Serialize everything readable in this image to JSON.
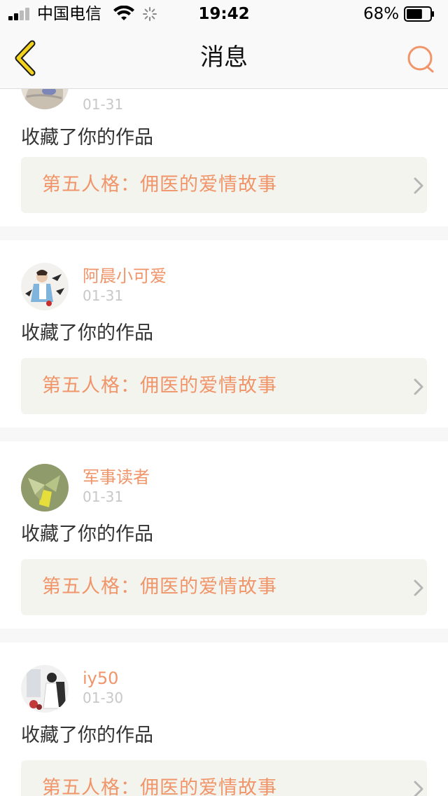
{
  "status_bar": {
    "carrier": "中国电信",
    "time": "19:42",
    "battery": "68%",
    "battery_level": 0.68,
    "icons": [
      "signal-icon",
      "wifi-icon",
      "activity-spinner-icon",
      "battery-icon"
    ]
  },
  "nav": {
    "title": "消息",
    "back_icon": "chevron-left-icon",
    "search_icon": "search-icon"
  },
  "colors": {
    "accent": "#f0956a",
    "back_icon_yellow": "#f2d21c",
    "date_gray": "#c8c8c8",
    "link_bg": "#f4f4ee",
    "page_bg": "#f7f7f7"
  },
  "messages": [
    {
      "username": "",
      "date": "01-31",
      "action": "收藏了你的作品",
      "work_title": "第五人格：佣医的爱情故事"
    },
    {
      "username": "阿晨小可爱",
      "date": "01-31",
      "action": "收藏了你的作品",
      "work_title": "第五人格：佣医的爱情故事"
    },
    {
      "username": "军事读者",
      "date": "01-31",
      "action": "收藏了你的作品",
      "work_title": "第五人格：佣医的爱情故事"
    },
    {
      "username": "iy50",
      "date": "01-30",
      "action": "收藏了你的作品",
      "work_title": "第五人格：佣医的爱情故事"
    }
  ]
}
